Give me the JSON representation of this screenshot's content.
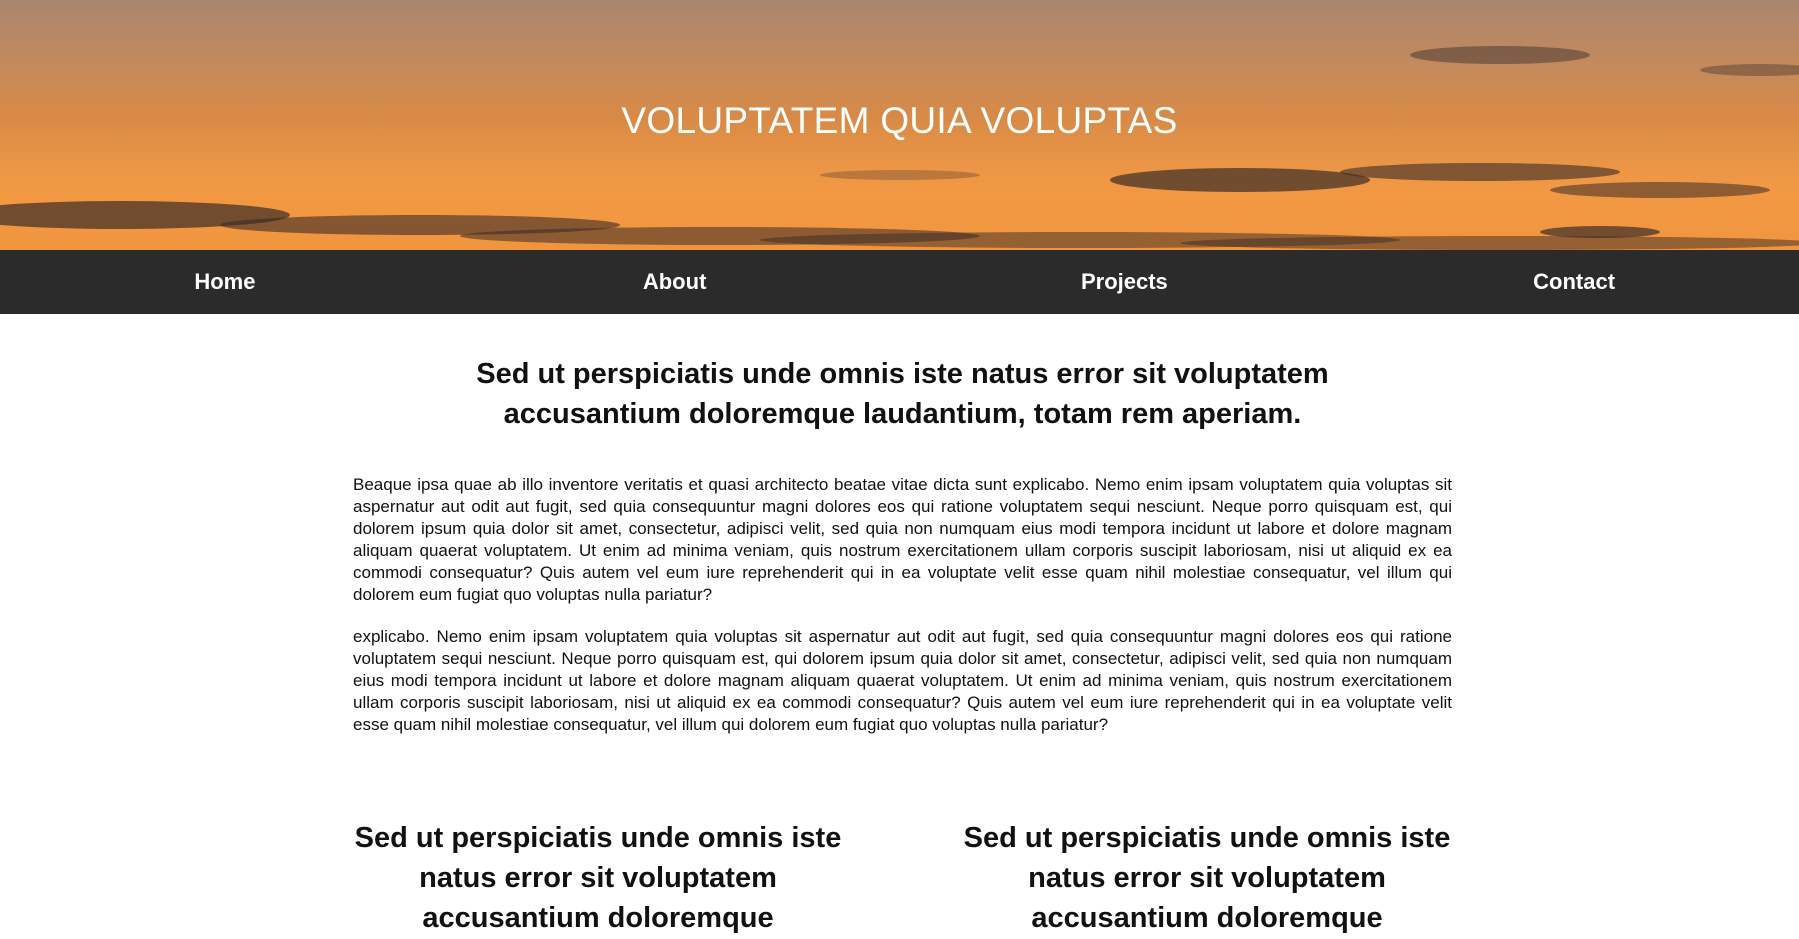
{
  "header": {
    "title": "VOLUPTATEM QUIA VOLUPTAS"
  },
  "nav": {
    "items": [
      "Home",
      "About",
      "Projects",
      "Contact"
    ]
  },
  "main": {
    "lead": "Sed ut perspiciatis unde omnis iste natus error sit voluptatem accusantium doloremque laudantium, totam rem aperiam.",
    "paragraphs": [
      "Beaque ipsa quae ab illo inventore veritatis et quasi architecto beatae vitae dicta sunt explicabo. Nemo enim ipsam voluptatem quia voluptas sit aspernatur aut odit aut fugit, sed quia consequuntur magni dolores eos qui ratione voluptatem sequi nesciunt. Neque porro quisquam est, qui dolorem ipsum quia dolor sit amet, consectetur, adipisci velit, sed quia non numquam eius modi tempora incidunt ut labore et dolore magnam aliquam quaerat voluptatem. Ut enim ad minima veniam, quis nostrum exercitationem ullam corporis suscipit laboriosam, nisi ut aliquid ex ea commodi consequatur? Quis autem vel eum iure reprehenderit qui in ea voluptate velit esse quam nihil molestiae consequatur, vel illum qui dolorem eum fugiat quo voluptas nulla pariatur?",
      "explicabo. Nemo enim ipsam voluptatem quia voluptas sit aspernatur aut odit aut fugit, sed quia consequuntur magni dolores eos qui ratione voluptatem sequi nesciunt. Neque porro quisquam est, qui dolorem ipsum quia dolor sit amet, consectetur, adipisci velit, sed quia non numquam eius modi tempora incidunt ut labore et dolore magnam aliquam quaerat voluptatem. Ut enim ad minima veniam, quis nostrum exercitationem ullam corporis suscipit laboriosam, nisi ut aliquid ex ea commodi consequatur? Quis autem vel eum iure reprehenderit qui in ea voluptate velit esse quam nihil molestiae consequatur, vel illum qui dolorem eum fugiat quo voluptas nulla pariatur?"
    ],
    "columns": [
      "Sed ut perspiciatis unde omnis iste natus error sit voluptatem accusantium doloremque",
      "Sed ut perspiciatis unde omnis iste natus error sit voluptatem accusantium doloremque"
    ]
  },
  "colors": {
    "nav_background": "#2b2b2b",
    "hero_sky_top": "#a8866f",
    "hero_sky_bottom": "#f08a2a",
    "text": "#111111"
  }
}
